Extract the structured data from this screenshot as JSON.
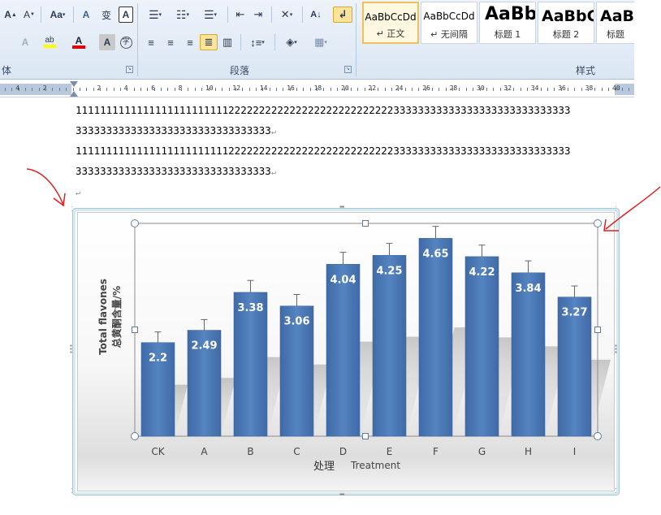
{
  "ribbon": {
    "font_group_label": "体",
    "paragraph_group_label": "段落",
    "styles_group_label": "样式",
    "font_buttons": [
      "A",
      "A",
      "Aa",
      "A",
      "A",
      "A",
      "A",
      "A"
    ],
    "styles": [
      {
        "sample": "AaBbCcDd",
        "name": "↵ 正文",
        "selected": true
      },
      {
        "sample": "AaBbCcDd",
        "name": "↵ 无间隔",
        "selected": false
      },
      {
        "sample": "AaBb",
        "name": "标题 1",
        "selected": false
      },
      {
        "sample": "AaBbC",
        "name": "标题 2",
        "selected": false
      },
      {
        "sample": "AaBl",
        "name": "标题",
        "selected": false
      }
    ]
  },
  "ruler": {
    "numbers": [
      "4",
      "2",
      "2",
      "4",
      "6",
      "8",
      "10",
      "12",
      "14",
      "16",
      "18",
      "20",
      "22",
      "24",
      "26",
      "28",
      "30",
      "32",
      "34",
      "36",
      "38",
      "40"
    ]
  },
  "document": {
    "lines": [
      "111111111111111111111111122222222222222222222222222233333333333333333333333333333",
      "33333333333333333333333333333333",
      "111111111111111111111111122222222222222222222222222233333333333333333333333333333",
      "33333333333333333333333333333333"
    ],
    "paragraph_mark": "↵"
  },
  "chart_data": {
    "type": "bar",
    "categories": [
      "CK",
      "A",
      "B",
      "C",
      "D",
      "E",
      "F",
      "G",
      "H",
      "I"
    ],
    "values": [
      2.2,
      2.49,
      3.38,
      3.06,
      4.04,
      4.25,
      4.65,
      4.22,
      3.84,
      3.27
    ],
    "errors": [
      0.25,
      0.25,
      0.28,
      0.27,
      0.28,
      0.28,
      0.28,
      0.27,
      0.28,
      0.26
    ],
    "data_labels": [
      "2.2",
      "2.49",
      "3.38",
      "3.06",
      "4.04",
      "4.25",
      "4.65",
      "4.22",
      "3.84",
      "3.27"
    ],
    "title": "",
    "xlabel_cn": "处理",
    "xlabel_en": "Treatment",
    "ylabel_en": "Total flavones",
    "ylabel_cn": "总黄酮含量/%",
    "ylim": [
      0,
      5
    ],
    "grid": false,
    "colors": {
      "bar": "#4a77b4",
      "bar_light": "#5b8ac7",
      "error": "#666666",
      "label": "#ffffff"
    }
  },
  "colors": {
    "ribbon_bg": "#dbe6f4",
    "selected_style": "#f1c05a",
    "selection_handle": "#4f81bd"
  }
}
